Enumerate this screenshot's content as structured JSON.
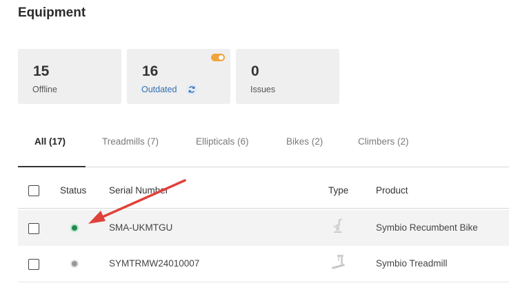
{
  "page": {
    "title": "Equipment"
  },
  "cards": [
    {
      "value": "15",
      "label": "Offline"
    },
    {
      "value": "16",
      "label": "Outdated",
      "icon": "sync-icon",
      "badge": "toggle-icon"
    },
    {
      "value": "0",
      "label": "Issues"
    }
  ],
  "tabs": [
    {
      "label": "All (17)",
      "active": true
    },
    {
      "label": "Treadmills (7)"
    },
    {
      "label": "Ellipticals (6)"
    },
    {
      "label": "Bikes (2)"
    },
    {
      "label": "Climbers (2)"
    }
  ],
  "table": {
    "columns": {
      "status": "Status",
      "serial": "Serial Number",
      "type": "Type",
      "product": "Product"
    },
    "rows": [
      {
        "status": "online",
        "status_color": "#1f8a53",
        "serial": "SMA-UKMTGU",
        "type_icon": "recumbent-bike-icon",
        "product": "Symbio Recumbent Bike"
      },
      {
        "status": "offline",
        "status_color": "#999999",
        "serial": "SYMTRMW24010007",
        "type_icon": "treadmill-icon",
        "product": "Symbio Treadmill"
      }
    ]
  },
  "colors": {
    "accent": "#f2a33a",
    "link": "#2f6fb3",
    "annotation_arrow": "#e0413a"
  }
}
